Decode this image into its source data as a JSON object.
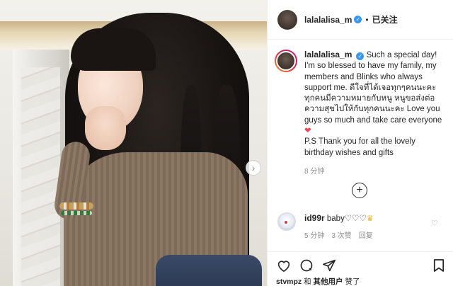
{
  "post": {
    "username": "lalalalisa_m",
    "follow_status": "已关注",
    "next_icon": "chevron-right-icon"
  },
  "caption": {
    "username": "lalalalisa_m",
    "text_line1": "Such a special day!",
    "text_body": "I'm so blessed to have my family, my members and Blinks who always support me. ดีใจที่ได้เจอทุกๆคนนะคะ ทุกคนมีความหมายกับหนู หนูขอส่งต่อความสุขไปให้กับทุกคนนะคะ Love you guys so much and take care everyone",
    "heart_emoji": "❤",
    "ps_line": "P.S Thank you for all the lovely birthday wishes and gifts",
    "time": "8 分钟"
  },
  "comment": {
    "username": "id99r",
    "text": "baby♡♡♡",
    "crown": "♛",
    "time": "5 分钟",
    "likes": "3 次赞",
    "reply": "回复"
  },
  "actions": {
    "like_icon": "heart-icon",
    "comment_icon": "comment-icon",
    "share_icon": "share-icon",
    "save_icon": "bookmark-icon"
  },
  "liked_by": {
    "user": "stvmpz",
    "and": "和",
    "others": "其他用户",
    "suffix": "赞了"
  },
  "colors": {
    "verified": "#3897f0",
    "text": "#262626",
    "meta": "#8e8e8e",
    "heart": "#ed4956"
  }
}
